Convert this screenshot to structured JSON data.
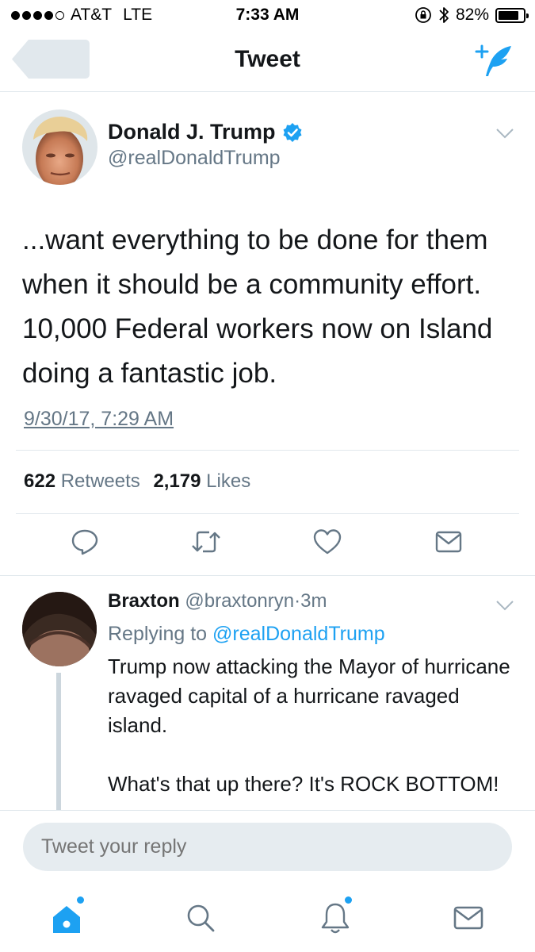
{
  "status_bar": {
    "carrier": "AT&T",
    "network": "LTE",
    "time": "7:33 AM",
    "battery_percent": "82%",
    "battery_level": 0.82
  },
  "nav": {
    "title": "Tweet"
  },
  "tweet": {
    "author_name": "Donald J. Trump",
    "author_handle": "@realDonaldTrump",
    "text": "...want everything to be done for them when it should be a community effort. 10,000 Federal workers now on Island doing a fantastic job.",
    "timestamp": "9/30/17, 7:29 AM",
    "retweets_count": "622",
    "retweets_label": "Retweets",
    "likes_count": "2,179",
    "likes_label": "Likes"
  },
  "reply": {
    "name": "Braxton",
    "handle": "@braxtonryn",
    "separator": "·",
    "age": "3m",
    "replying_to_label": "Replying to",
    "replying_to_handle": "@realDonaldTrump",
    "text": "Trump now attacking the Mayor of hurricane ravaged capital of a hurricane ravaged island.\n\nWhat's that up there? It's ROCK BOTTOM!"
  },
  "composer": {
    "placeholder": "Tweet your reply"
  },
  "colors": {
    "accent": "#1da1f2",
    "secondary_text": "#657786",
    "divider": "#e1e8ed"
  },
  "icons": {
    "back": "back-arrow-icon",
    "compose": "compose-tweet-icon",
    "verified": "verified-badge-icon",
    "chevron": "chevron-down-icon",
    "reply": "reply-icon",
    "retweet": "retweet-icon",
    "like": "heart-icon",
    "dm": "envelope-icon",
    "home": "home-icon",
    "search": "search-icon",
    "notifications": "bell-icon",
    "messages": "envelope-icon"
  }
}
